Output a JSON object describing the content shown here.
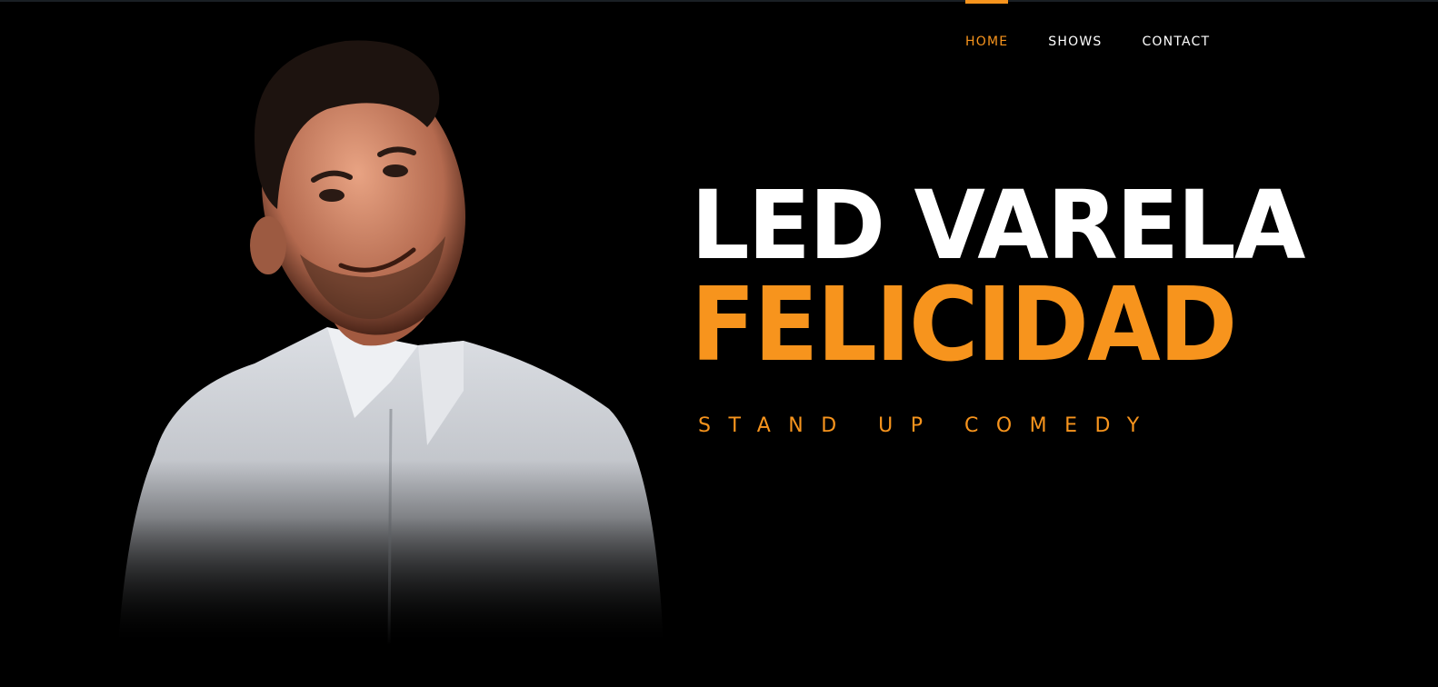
{
  "nav": {
    "items": [
      {
        "label": "HOME",
        "active": true
      },
      {
        "label": "SHOWS",
        "active": false
      },
      {
        "label": "CONTACT",
        "active": false
      }
    ]
  },
  "hero": {
    "name": "LED VARELA",
    "show_title": "FELICIDAD",
    "tagline": "STAND UP COMEDY"
  },
  "colors": {
    "background": "#000000",
    "accent": "#f7941d",
    "text": "#ffffff"
  }
}
